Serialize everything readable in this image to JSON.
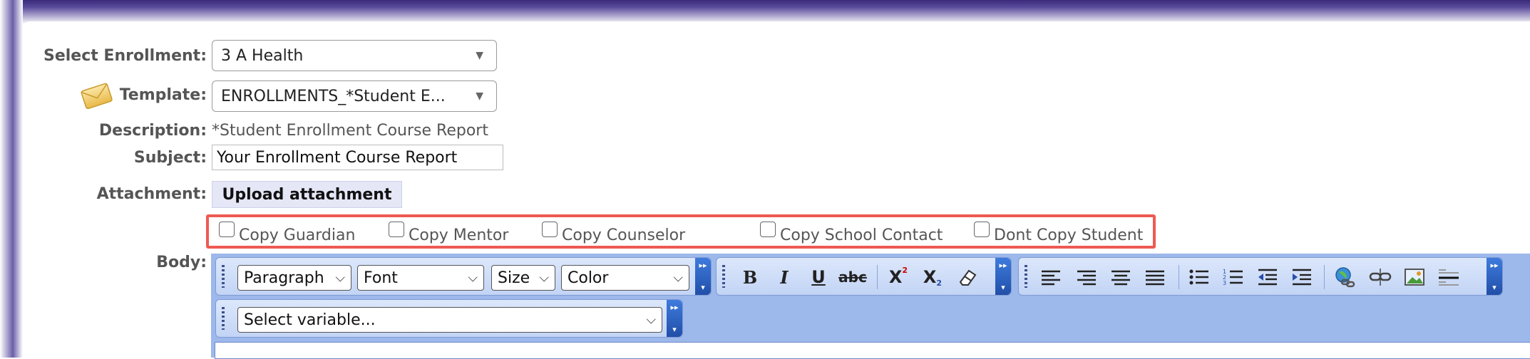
{
  "form": {
    "enrollment_label": "Select Enrollment:",
    "enrollment_value": "3 A Health",
    "template_label": "Template:",
    "template_value": "ENROLLMENTS_*Student E...",
    "description_label": "Description:",
    "description_value": "*Student Enrollment Course Report",
    "subject_label": "Subject:",
    "subject_value": "Your Enrollment Course Report",
    "attachment_label": "Attachment:",
    "upload_label": "Upload attachment",
    "body_label": "Body:"
  },
  "copy_options": [
    {
      "label": "Copy Guardian",
      "checked": false
    },
    {
      "label": "Copy Mentor",
      "checked": false
    },
    {
      "label": "Copy Counselor",
      "checked": false
    },
    {
      "label": "Copy School Contact",
      "checked": false
    },
    {
      "label": "Dont Copy Student",
      "checked": false
    }
  ],
  "toolbar": {
    "paragraph": "Paragraph",
    "font": "Font",
    "size": "Size",
    "color": "Color",
    "variable": "Select variable...",
    "bold": "B",
    "italic": "I",
    "underline": "U",
    "strike": "abc",
    "superscript": "X",
    "subscript": "X"
  },
  "colors": {
    "highlight": "#ee5a52",
    "toolbar_bg": "#9db8ea",
    "upload_bg": "#e5e6f6"
  },
  "icons": [
    "envelope-icon",
    "eraser-icon",
    "align-left-icon",
    "align-right-icon",
    "align-center-icon",
    "align-justify-icon",
    "bullet-list-icon",
    "numbered-list-icon",
    "outdent-icon",
    "indent-icon",
    "link-icon",
    "unlink-icon",
    "image-icon",
    "horizontal-rule-icon"
  ]
}
